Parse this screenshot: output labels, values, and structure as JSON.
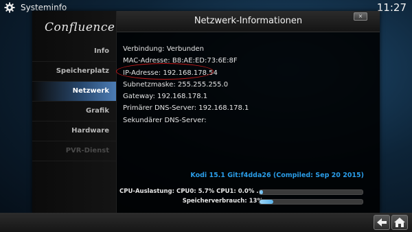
{
  "topbar": {
    "title": "Systeminfo",
    "time": "11:27"
  },
  "sidebar": {
    "logo": "Confluence",
    "items": [
      {
        "label": "Info",
        "state": "normal"
      },
      {
        "label": "Speicherplatz",
        "state": "normal"
      },
      {
        "label": "Netzwerk",
        "state": "active"
      },
      {
        "label": "Grafik",
        "state": "normal"
      },
      {
        "label": "Hardware",
        "state": "normal"
      },
      {
        "label": "PVR-Dienst",
        "state": "disabled"
      }
    ]
  },
  "header": {
    "title": "Netzwerk-Informationen",
    "close_label": "×"
  },
  "network": {
    "lines": [
      "Verbindung: Verbunden",
      "MAC-Adresse: B8:AE:ED:73:6E:8F",
      "IP-Adresse: 192.168.178.54",
      "Subnetzmaske: 255.255.255.0",
      "Gateway: 192.168.178.1",
      "Primärer DNS-Server: 192.168.178.1",
      "Sekundärer DNS-Server:"
    ]
  },
  "footer": {
    "version": "Kodi 15.1 Git:f4dda26 (Compiled: Sep 20 2015)",
    "cpu": {
      "label": "CPU-Auslastung: CPU0: 5.7% CPU1: 0.0% ...",
      "percent": 3
    },
    "memory": {
      "label": "Speicherverbrauch: 13%",
      "percent": 13
    }
  },
  "colors": {
    "accent": "#2a9de8",
    "highlight": "#c41a1a"
  },
  "icons": {
    "topbar": "gear-icon",
    "nav_back": "back-arrow-icon",
    "nav_home": "home-icon"
  }
}
